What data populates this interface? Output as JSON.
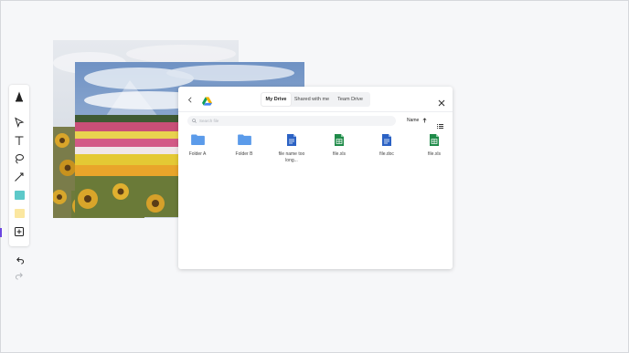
{
  "canvas": {
    "photos": [
      {
        "name": "cloudy-sky-photo"
      },
      {
        "name": "flower-field-photo"
      }
    ]
  },
  "toolbar": {
    "tools": [
      {
        "name": "logo-icon"
      },
      {
        "name": "select-arrow-icon"
      },
      {
        "name": "text-tool-icon"
      },
      {
        "name": "lasso-tool-icon"
      },
      {
        "name": "line-tool-icon"
      },
      {
        "name": "sticky-note-teal",
        "color": "#5dc9c9"
      },
      {
        "name": "sticky-note-yellow",
        "color": "#fbe7a0"
      },
      {
        "name": "add-frame-icon"
      }
    ],
    "undo_icon": "undo-icon",
    "redo_icon": "redo-icon",
    "active_color": "#6b45e0"
  },
  "dialog": {
    "tabs": [
      {
        "label": "My Drive",
        "active": true
      },
      {
        "label": "Shared with me",
        "active": false
      },
      {
        "label": "Team Drive",
        "active": false
      }
    ],
    "search": {
      "placeholder": "Search file",
      "value": ""
    },
    "sort": {
      "label": "Name",
      "direction": "ascending"
    },
    "files": [
      {
        "type": "folder",
        "name": "Folder A",
        "color": "#5b9bea"
      },
      {
        "type": "folder",
        "name": "Folder B",
        "color": "#5b9bea"
      },
      {
        "type": "doc",
        "name": "file name too long...",
        "color": "#2b62c4"
      },
      {
        "type": "sheet",
        "name": "file.xls",
        "color": "#1f8b49"
      },
      {
        "type": "doc",
        "name": "file.doc",
        "color": "#2b62c4"
      },
      {
        "type": "sheet",
        "name": "file.xls",
        "color": "#1f8b49"
      }
    ]
  }
}
